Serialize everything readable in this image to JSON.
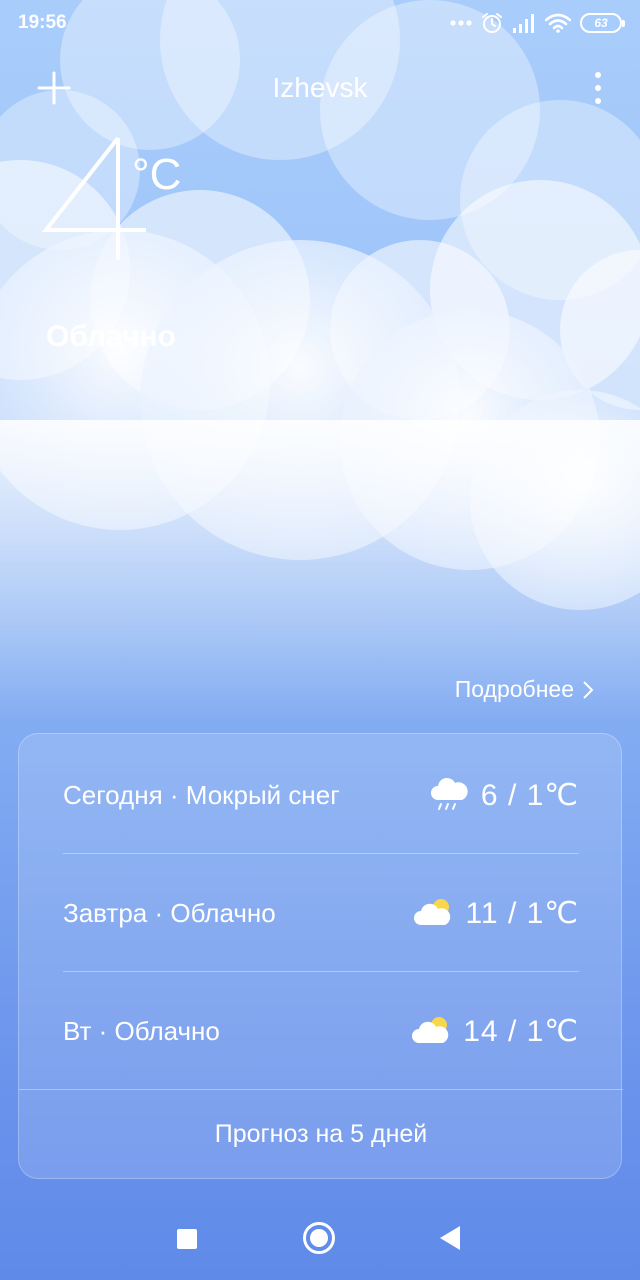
{
  "status_bar": {
    "time": "19:56",
    "battery": "63",
    "icons": [
      "more-dots-icon",
      "alarm-icon",
      "signal-icon",
      "wifi-icon",
      "battery-icon"
    ]
  },
  "header": {
    "city": "Izhevsk",
    "add_icon": "plus-icon",
    "menu_icon": "more-vertical-icon"
  },
  "current": {
    "temperature": "4",
    "unit": "°C",
    "condition": "Облачно"
  },
  "details_link": {
    "label": "Подробнее",
    "icon": "chevron-right-icon"
  },
  "forecast": [
    {
      "label": "Сегодня · Мокрый снег",
      "icon": "sleet-icon",
      "high": "6",
      "low": "1℃",
      "temps": "6  /  1℃"
    },
    {
      "label": "Завтра · Облачно",
      "icon": "partly-cloudy-icon",
      "high": "11",
      "low": "1℃",
      "temps": "11  /  1℃"
    },
    {
      "label": "Вт · Облачно",
      "icon": "partly-cloudy-icon",
      "high": "14",
      "low": "1℃",
      "temps": "14  /  1℃"
    }
  ],
  "forecast_button": "Прогноз на 5 дней",
  "nav": {
    "recents_icon": "square-icon",
    "home_icon": "circle-icon",
    "back_icon": "back-triangle-icon"
  },
  "colors": {
    "sky_top": "#a9cdfb",
    "sky_bottom": "#5f8ae8",
    "sun": "#f8d74a"
  }
}
